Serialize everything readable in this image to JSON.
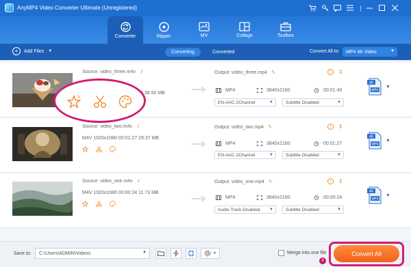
{
  "app": {
    "title": "AnyMP4 Video Converter Ultimate (Unregistered)"
  },
  "nav": {
    "tabs": [
      {
        "label": "Converter",
        "icon": "convert-icon"
      },
      {
        "label": "Ripper",
        "icon": "disc-icon"
      },
      {
        "label": "MV",
        "icon": "mv-icon"
      },
      {
        "label": "Collage",
        "icon": "collage-icon"
      },
      {
        "label": "Toolbox",
        "icon": "toolbox-icon"
      }
    ],
    "active": "Converter"
  },
  "subbar": {
    "add_files": "Add Files",
    "tab_converting": "Converting",
    "tab_converted": "Converted",
    "convert_all_to_label": "Convert All to:",
    "format": "MP4 4K Video"
  },
  "files": [
    {
      "source": "Source: video_three.m4v",
      "meta_visible": "40   38.50 MB",
      "output": "Output: video_three.mp4",
      "format": "MP4",
      "resolution": "3840x2160",
      "duration": "00:01:40",
      "audio": "EN-AAC-2Channel",
      "subtitle": "Subtitle Disabled",
      "badge_top": "4K",
      "badge_bottom": "MP4"
    },
    {
      "source": "Source: video_two.m4v",
      "meta_visible": "M4V   1920x1080   00:01:27   29.37 MB",
      "output": "Output: video_two.mp4",
      "format": "MP4",
      "resolution": "3840x2160",
      "duration": "00:01:27",
      "audio": "EN-AAC-2Channel",
      "subtitle": "Subtitle Disabled",
      "badge_top": "4K",
      "badge_bottom": "MP4"
    },
    {
      "source": "Source: video_one.m4v",
      "meta_visible": "M4V   1920x1080   00:00:24   11.73 MB",
      "output": "Output: video_one.mp4",
      "format": "MP4",
      "resolution": "3840x2160",
      "duration": "00:00:24",
      "audio": "Audio Track Disabled",
      "subtitle": "Subtitle Disabled",
      "badge_top": "4K",
      "badge_bottom": "MP4"
    }
  ],
  "footer": {
    "save_to_label": "Save to:",
    "save_path": "C:\\Users\\ADMIN\\Videos",
    "merge_label": "Merge into one file",
    "convert_all": "Convert All",
    "badge": "9"
  },
  "colors": {
    "primary": "#1f6fd1",
    "accent": "#f0621c",
    "highlight": "#d51b73"
  }
}
